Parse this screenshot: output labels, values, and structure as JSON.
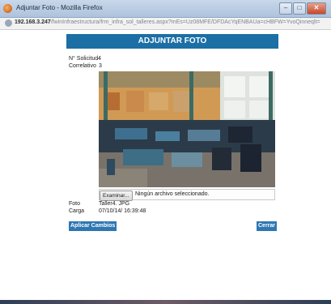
{
  "browser": {
    "title": "Adjuntar Foto - Mozilla Firefox",
    "url_host": "192.168.3.247",
    "url_path": "/fwinInfraestructura/frm_infra_sol_talleres.aspx?mEs=Uz08MFE/DFDAcYqENBAUa=cHBFW=YvoQinneqlt="
  },
  "header": {
    "title": "ADJUNTAR FOTO"
  },
  "details": {
    "solicitud_label": "N° Solicitud",
    "solicitud_value": "4",
    "correlativo_label": "Correlativo",
    "correlativo_value": "3"
  },
  "upload": {
    "browse_label": "Examinar...",
    "status_text": "Ningún archivo seleccionado."
  },
  "meta": {
    "foto_label": "Foto",
    "foto_value": "Taller4. JPG",
    "carga_label": "Carga",
    "carga_value": "07/10/14/ 16:39:48"
  },
  "actions": {
    "apply_label": "Aplicar Cambios",
    "close_label": "Cerrar"
  },
  "colors": {
    "header_bg": "#1b6fa5",
    "button_bg": "#2f77b2"
  },
  "icons": {
    "window": "firefox-icon",
    "minimize": "minimize-icon",
    "maximize": "maximize-icon",
    "close": "close-icon",
    "page": "page-icon"
  }
}
